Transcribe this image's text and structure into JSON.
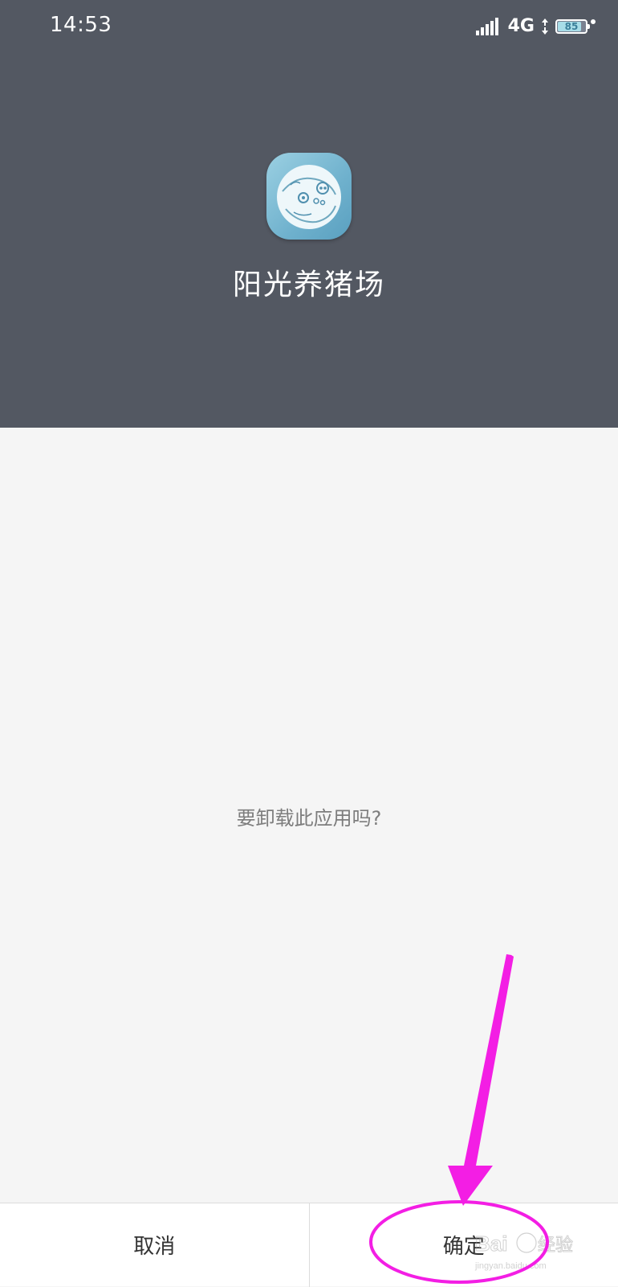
{
  "status_bar": {
    "time": "14:53",
    "network": "4G",
    "battery": "85",
    "battery_level": 0.85,
    "icons": [
      "signal-icon",
      "data-arrows-icon",
      "battery-icon",
      "charge-dot-icon"
    ]
  },
  "app": {
    "name": "阳光养猪场",
    "icon": "pig-cartoon-app-icon"
  },
  "dialog": {
    "question": "要卸载此应用吗?"
  },
  "buttons": {
    "cancel": "取消",
    "confirm": "确定"
  },
  "annotation": {
    "color": "#f31ee4",
    "shapes": [
      "arrow",
      "ellipse"
    ]
  },
  "watermark": {
    "logo": "Bai du 经验",
    "url": "jingyan.baidu.com"
  },
  "colors": {
    "header_bg": "#535862",
    "content_bg": "#f5f5f5",
    "button_bg": "#ffffff"
  }
}
